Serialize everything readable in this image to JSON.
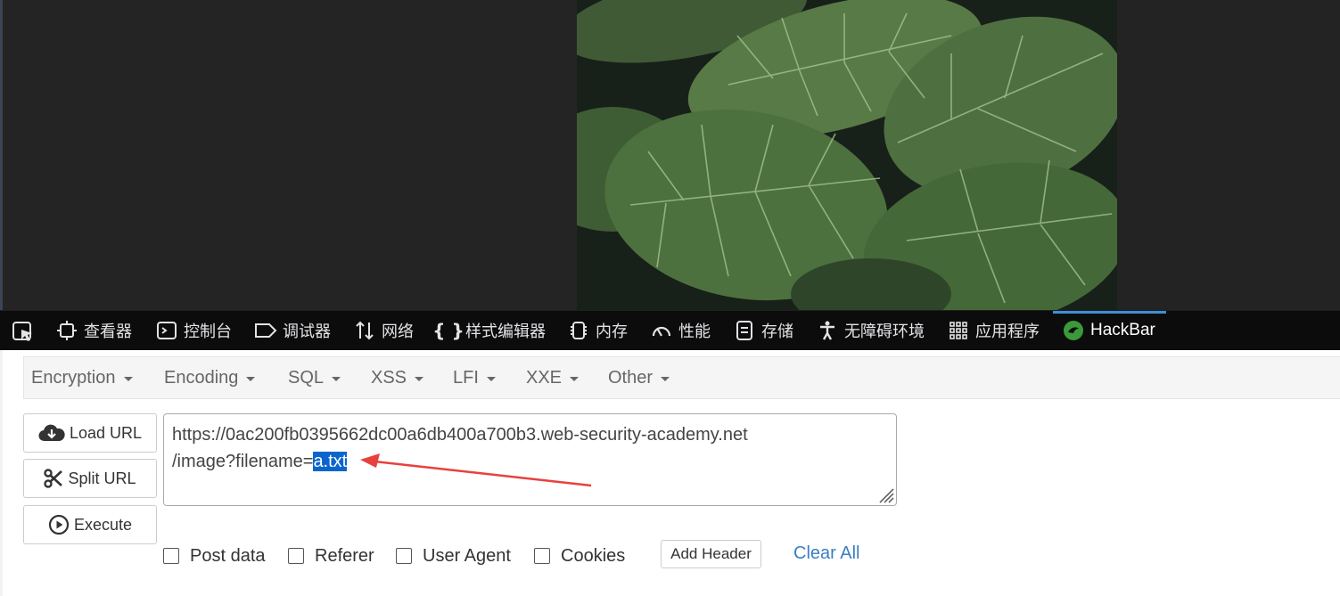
{
  "devtools": {
    "tabs": [
      {
        "label": "查看器",
        "icon": "inspector-icon"
      },
      {
        "label": "控制台",
        "icon": "console-icon"
      },
      {
        "label": "调试器",
        "icon": "debugger-icon"
      },
      {
        "label": "网络",
        "icon": "network-icon"
      },
      {
        "label": "样式编辑器",
        "icon": "style-editor-icon"
      },
      {
        "label": "内存",
        "icon": "memory-icon"
      },
      {
        "label": "性能",
        "icon": "performance-icon"
      },
      {
        "label": "存储",
        "icon": "storage-icon"
      },
      {
        "label": "无障碍环境",
        "icon": "accessibility-icon"
      },
      {
        "label": "应用程序",
        "icon": "application-icon"
      },
      {
        "label": "HackBar",
        "icon": "hackbar-icon"
      }
    ],
    "active_tab": "HackBar",
    "accent_color": "#3d8fd6"
  },
  "hackbar": {
    "menu": [
      "Encryption",
      "Encoding",
      "SQL",
      "XSS",
      "LFI",
      "XXE",
      "Other"
    ],
    "buttons": {
      "load_url": "Load URL",
      "split_url": "Split URL",
      "execute": "Execute"
    },
    "url": {
      "line1": "https://0ac200fb0395662dc00a6db400a700b3.web-security-academy.net",
      "line2_prefix": "/image?filename=",
      "line2_selected": "a.txt"
    },
    "options": {
      "post_data": "Post data",
      "referer": "Referer",
      "user_agent": "User Agent",
      "cookies": "Cookies"
    },
    "add_header": "Add Header",
    "clear_all": "Clear All",
    "link_color": "#3a7fc2",
    "selection_color": "#0a66cc",
    "annotation_color": "#e8413c"
  }
}
